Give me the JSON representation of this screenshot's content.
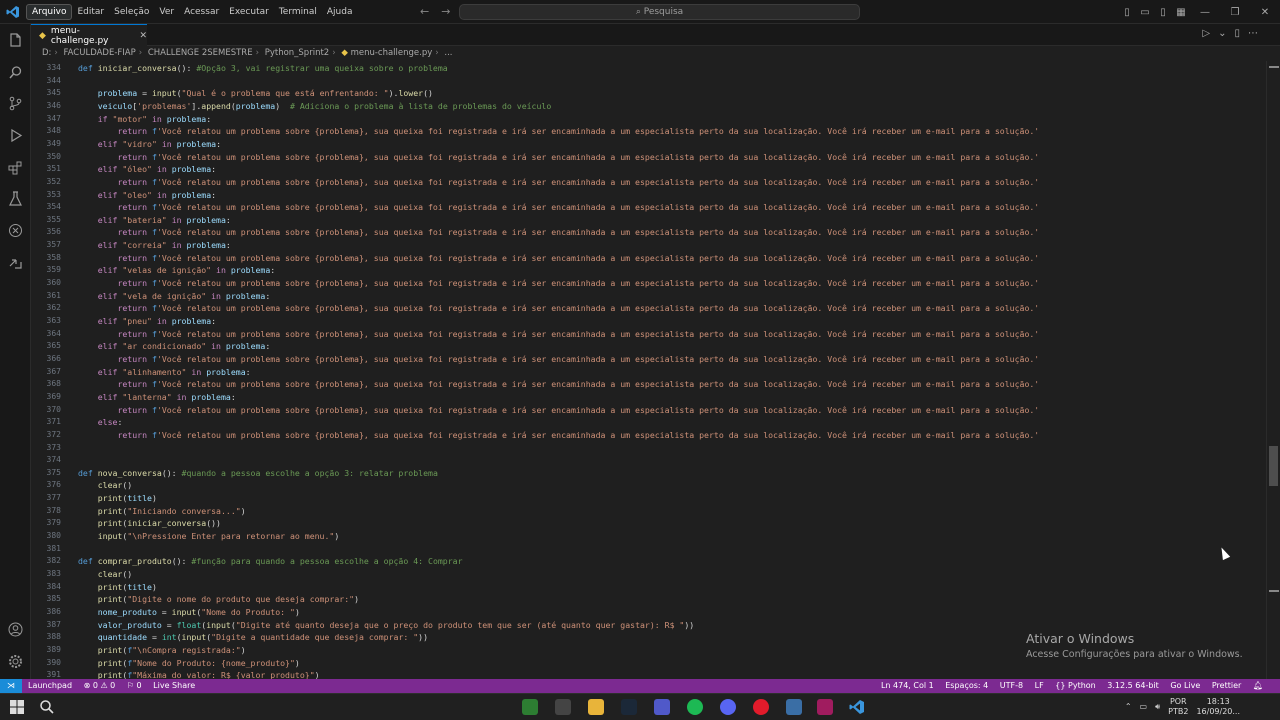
{
  "titlebar": {
    "menus": [
      "Arquivo",
      "Editar",
      "Seleção",
      "Ver",
      "Acessar",
      "Executar",
      "Terminal",
      "Ajuda"
    ],
    "search_placeholder": "Pesquisa"
  },
  "tab": {
    "filename": "menu-challenge.py"
  },
  "breadcrumb": [
    "D:",
    "FACULDADE-FIAP",
    "CHALLENGE 2SEMESTRE",
    "Python_Sprint2",
    "menu-challenge.py",
    "..."
  ],
  "code": {
    "lines": [
      {
        "n": "334",
        "t": "def iniciar_conversa(): #Opção 3, vai registrar uma queixa sobre o problema"
      },
      {
        "n": "344",
        "t": ""
      },
      {
        "n": "345",
        "t": "    problema = input(\"Qual é o problema que está enfrentando: \").lower()"
      },
      {
        "n": "346",
        "t": "    veiculo['problemas'].append(problema)  # Adiciona o problema à lista de problemas do veículo"
      },
      {
        "n": "347",
        "t": "    if \"motor\" in problema:"
      },
      {
        "n": "348",
        "t": "        return f'Você relatou um problema sobre {problema}, sua queixa foi registrada e irá ser encaminhada a um especialista perto da sua localização. Você irá receber um e-mail para a solução.'"
      },
      {
        "n": "349",
        "t": "    elif \"vidro\" in problema:"
      },
      {
        "n": "350",
        "t": "        return f'Você relatou um problema sobre {problema}, sua queixa foi registrada e irá ser encaminhada a um especialista perto da sua localização. Você irá receber um e-mail para a solução.'"
      },
      {
        "n": "351",
        "t": "    elif \"óleo\" in problema:"
      },
      {
        "n": "352",
        "t": "        return f'Você relatou um problema sobre {problema}, sua queixa foi registrada e irá ser encaminhada a um especialista perto da sua localização. Você irá receber um e-mail para a solução.'"
      },
      {
        "n": "353",
        "t": "    elif \"oleo\" in problema:"
      },
      {
        "n": "354",
        "t": "        return f'Você relatou um problema sobre {problema}, sua queixa foi registrada e irá ser encaminhada a um especialista perto da sua localização. Você irá receber um e-mail para a solução.'"
      },
      {
        "n": "355",
        "t": "    elif \"bateria\" in problema:"
      },
      {
        "n": "356",
        "t": "        return f'Você relatou um problema sobre {problema}, sua queixa foi registrada e irá ser encaminhada a um especialista perto da sua localização. Você irá receber um e-mail para a solução.'"
      },
      {
        "n": "357",
        "t": "    elif \"correia\" in problema:"
      },
      {
        "n": "358",
        "t": "        return f'Você relatou um problema sobre {problema}, sua queixa foi registrada e irá ser encaminhada a um especialista perto da sua localização. Você irá receber um e-mail para a solução.'"
      },
      {
        "n": "359",
        "t": "    elif \"velas de ignição\" in problema:"
      },
      {
        "n": "360",
        "t": "        return f'Você relatou um problema sobre {problema}, sua queixa foi registrada e irá ser encaminhada a um especialista perto da sua localização. Você irá receber um e-mail para a solução.'"
      },
      {
        "n": "361",
        "t": "    elif \"vela de ignição\" in problema:"
      },
      {
        "n": "362",
        "t": "        return f'Você relatou um problema sobre {problema}, sua queixa foi registrada e irá ser encaminhada a um especialista perto da sua localização. Você irá receber um e-mail para a solução.'"
      },
      {
        "n": "363",
        "t": "    elif \"pneu\" in problema:"
      },
      {
        "n": "364",
        "t": "        return f'Você relatou um problema sobre {problema}, sua queixa foi registrada e irá ser encaminhada a um especialista perto da sua localização. Você irá receber um e-mail para a solução.'"
      },
      {
        "n": "365",
        "t": "    elif \"ar condicionado\" in problema:"
      },
      {
        "n": "366",
        "t": "        return f'Você relatou um problema sobre {problema}, sua queixa foi registrada e irá ser encaminhada a um especialista perto da sua localização. Você irá receber um e-mail para a solução.'"
      },
      {
        "n": "367",
        "t": "    elif \"alinhamento\" in problema:"
      },
      {
        "n": "368",
        "t": "        return f'Você relatou um problema sobre {problema}, sua queixa foi registrada e irá ser encaminhada a um especialista perto da sua localização. Você irá receber um e-mail para a solução.'"
      },
      {
        "n": "369",
        "t": "    elif \"lanterna\" in problema:"
      },
      {
        "n": "370",
        "t": "        return f'Você relatou um problema sobre {problema}, sua queixa foi registrada e irá ser encaminhada a um especialista perto da sua localização. Você irá receber um e-mail para a solução.'"
      },
      {
        "n": "371",
        "t": "    else:"
      },
      {
        "n": "372",
        "t": "        return f'Você relatou um problema sobre {problema}, sua queixa foi registrada e irá ser encaminhada a um especialista perto da sua localização. Você irá receber um e-mail para a solução.'"
      },
      {
        "n": "373",
        "t": ""
      },
      {
        "n": "374",
        "t": ""
      },
      {
        "n": "375",
        "t": "def nova_conversa(): #quando a pessoa escolhe a opção 3: relatar problema"
      },
      {
        "n": "376",
        "t": "    clear()"
      },
      {
        "n": "377",
        "t": "    print(title)"
      },
      {
        "n": "378",
        "t": "    print(\"Iniciando conversa...\")"
      },
      {
        "n": "379",
        "t": "    print(iniciar_conversa())"
      },
      {
        "n": "380",
        "t": "    input(\"\\nPressione Enter para retornar ao menu.\")"
      },
      {
        "n": "381",
        "t": ""
      },
      {
        "n": "382",
        "t": "def comprar_produto(): #função para quando a pessoa escolhe a opção 4: Comprar"
      },
      {
        "n": "383",
        "t": "    clear()"
      },
      {
        "n": "384",
        "t": "    print(title)"
      },
      {
        "n": "385",
        "t": "    print(\"Digite o nome do produto que deseja comprar:\")"
      },
      {
        "n": "386",
        "t": "    nome_produto = input(\"Nome do Produto: \")"
      },
      {
        "n": "387",
        "t": "    valor_produto = float(input(\"Digite até quanto deseja que o preço do produto tem que ser (até quanto quer gastar): R$ \"))"
      },
      {
        "n": "388",
        "t": "    quantidade = int(input(\"Digite a quantidade que deseja comprar: \"))"
      },
      {
        "n": "389",
        "t": "    print(f\"\\nCompra registrada:\")"
      },
      {
        "n": "390",
        "t": "    print(f\"Nome do Produto: {nome_produto}\")"
      },
      {
        "n": "391",
        "t": "    print(f\"Máxima do valor: R$ {valor_produto}\")"
      }
    ]
  },
  "watermark": {
    "title": "Ativar o Windows",
    "subtitle": "Acesse Configurações para ativar o Windows."
  },
  "statusbar": {
    "left": [
      "Launchpad",
      "⊗ 0 ⚠ 0",
      "⚐ 0",
      "Live Share"
    ],
    "right": [
      "Ln 474, Col 1",
      "Espaços: 4",
      "UTF-8",
      "LF",
      "{} Python",
      "3.12.5 64-bit",
      "Go Live",
      "Prettier"
    ]
  },
  "taskbar": {
    "lang": "POR",
    "layout": "PTB2",
    "time": "18:13",
    "date": "16/09/20..."
  },
  "colors": {
    "accent": "#0078d4",
    "statusbar": "#7c2a91",
    "editor_bg": "#1f1f1f"
  }
}
